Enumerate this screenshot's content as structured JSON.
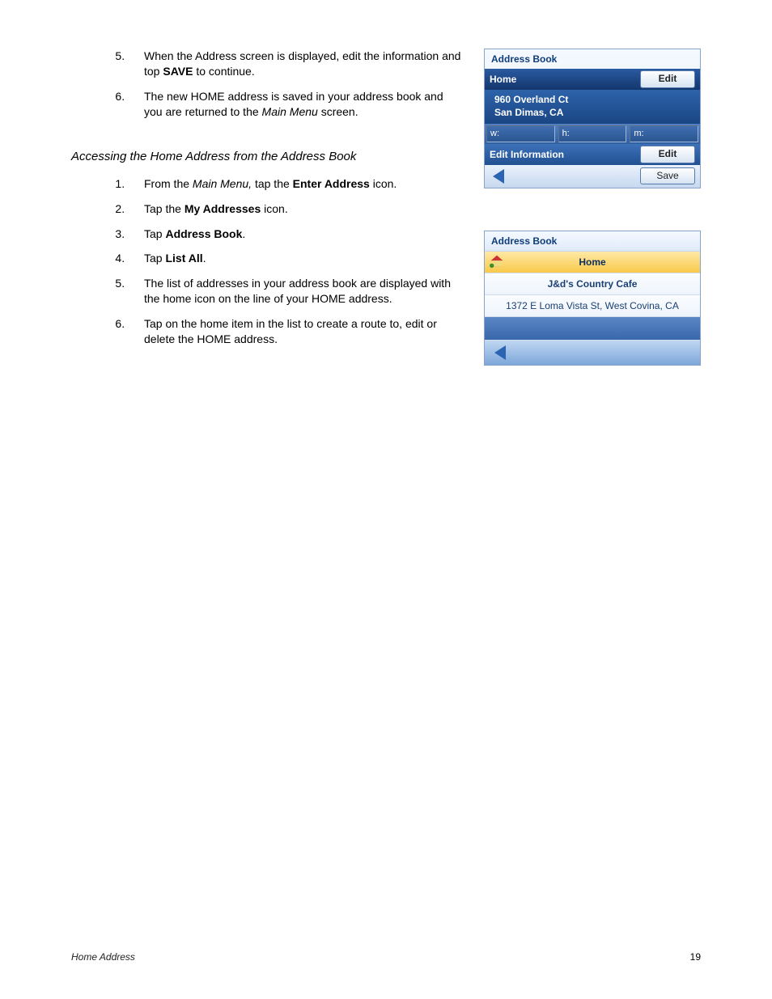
{
  "steps_a": {
    "5": {
      "pre": "When the Address screen is displayed, edit the information and top ",
      "bold": "SAVE",
      "post": " to continue."
    },
    "6": {
      "pre": "The new HOME address is saved in your address book and you are returned to the ",
      "ital": "Main Menu",
      "post": " screen."
    }
  },
  "section_title": "Accessing the Home Address from the Address Book",
  "steps_b": {
    "1": {
      "pre": "From the ",
      "ital": "Main Menu,",
      "mid": " tap the ",
      "bold": "Enter Address",
      "post": " icon."
    },
    "2": {
      "pre": "Tap the ",
      "bold": "My Addresses",
      "post": " icon."
    },
    "3": {
      "pre": "Tap ",
      "bold": "Address Book",
      "post": "."
    },
    "4": {
      "pre": "Tap ",
      "bold": "List All",
      "post": "."
    },
    "5": {
      "text": "The list of addresses in your address book are displayed with the home icon on the line of your HOME address."
    },
    "6": {
      "text": "Tap on the home item in the list to create a route to, edit or delete the HOME address."
    }
  },
  "fig1": {
    "title": "Address Book",
    "home_label": "Home",
    "edit_btn": "Edit",
    "addr_line1": "960 Overland Ct",
    "addr_line2": "San Dimas, CA",
    "phone_w": "w:",
    "phone_h": "h:",
    "phone_m": "m:",
    "edit_info": "Edit Information",
    "save_btn": "Save"
  },
  "fig2": {
    "title": "Address Book",
    "row_home": "Home",
    "row_cafe": "J&d's Country Cafe",
    "row_addr": "1372 E Loma Vista St, West Covina, CA"
  },
  "footer": {
    "section": "Home Address",
    "page": "19"
  }
}
